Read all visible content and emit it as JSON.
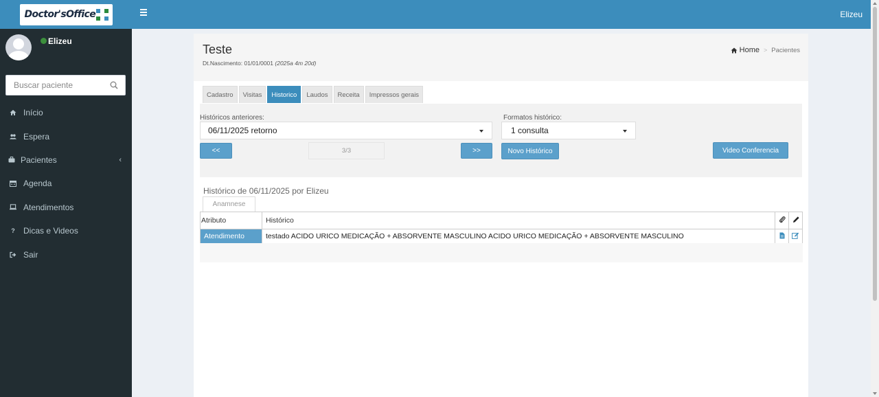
{
  "brand": {
    "logo_text": "Doctor'sOffice"
  },
  "topbar": {
    "user": "Elizeu"
  },
  "sidebar": {
    "user_name": "Elizeu",
    "search_placeholder": "Buscar paciente",
    "items": [
      {
        "label": "Início",
        "icon": "home-icon"
      },
      {
        "label": "Espera",
        "icon": "users-icon"
      },
      {
        "label": "Pacientes",
        "icon": "briefcase-icon"
      },
      {
        "label": "Agenda",
        "icon": "calendar-icon"
      },
      {
        "label": "Atendimentos",
        "icon": "laptop-icon"
      },
      {
        "label": "Dicas e Videos",
        "icon": "question-icon"
      },
      {
        "label": "Sair",
        "icon": "sign-out-icon"
      }
    ]
  },
  "patient": {
    "name": "Teste",
    "dob_prefix": "Dt.Nascimento: 01/01/0001",
    "dob_age": "(2025a 4m 20d)"
  },
  "breadcrumb": {
    "home": "Home",
    "current": "Pacientes"
  },
  "tabs": [
    "Cadastro",
    "Visitas",
    "Historico",
    "Laudos",
    "Receita",
    "Impressos gerais"
  ],
  "active_tab": "Historico",
  "form": {
    "previous_label": "Históricos anteriores:",
    "previous_value": "06/11/2025 retorno",
    "formats_label": "Formatos histórico:",
    "formats_value": "1 consulta",
    "prev_button": "<<",
    "pager": "3/3",
    "next_button": ">>",
    "new_button": "Novo Histórico",
    "video_button": "Video Conferencia"
  },
  "history": {
    "title": "Histórico de 06/11/2025 por Elizeu",
    "subtab": "Anamnese",
    "columns": [
      "Atributo",
      "Histórico"
    ],
    "rows": [
      {
        "attribute": "Atendimento",
        "value": "testado ACIDO URICO MEDICAÇÃO + ABSORVENTE MASCULINO ACIDO URICO MEDICAÇÃO + ABSORVENTE MASCULINO"
      }
    ]
  },
  "colors": {
    "primary": "#3c8dbc",
    "sidebar": "#222d32",
    "button": "#5ba0cb"
  }
}
